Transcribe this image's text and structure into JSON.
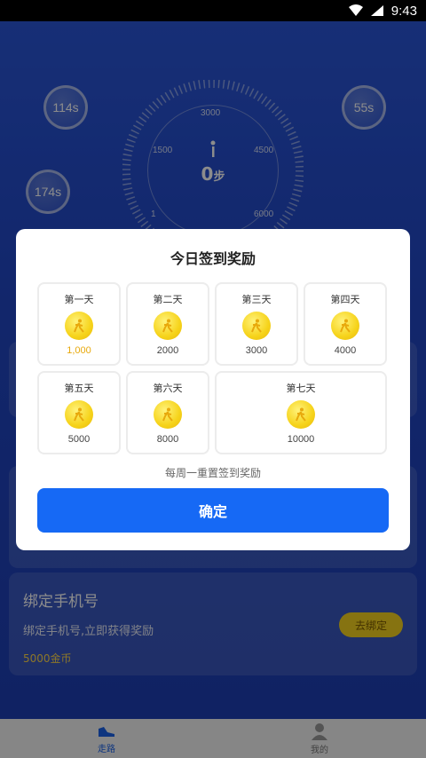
{
  "status_bar": {
    "time": "9:43"
  },
  "background": {
    "bubbles": [
      "114s",
      "55s",
      "174s"
    ],
    "gauge": {
      "ticks": [
        "3000",
        "1500",
        "4500",
        "1",
        "6000"
      ],
      "steps_value": "0",
      "steps_unit": "步"
    },
    "bind_card": {
      "title": "绑定手机号",
      "desc": "绑定手机号,立即获得奖励",
      "reward": "5000金币",
      "button": "去绑定"
    }
  },
  "tab_bar": {
    "tabs": [
      {
        "label": "走路",
        "icon": "shoe-icon",
        "active": true
      },
      {
        "label": "我的",
        "icon": "user-icon",
        "active": false
      }
    ]
  },
  "modal": {
    "title": "今日签到奖励",
    "days": [
      {
        "label": "第一天",
        "amount": "1,000",
        "highlight": true
      },
      {
        "label": "第二天",
        "amount": "2000"
      },
      {
        "label": "第三天",
        "amount": "3000"
      },
      {
        "label": "第四天",
        "amount": "4000"
      },
      {
        "label": "第五天",
        "amount": "5000"
      },
      {
        "label": "第六天",
        "amount": "8000"
      },
      {
        "label": "第七天",
        "amount": "10000"
      }
    ],
    "note": "每周一重置签到奖励",
    "confirm_label": "确定"
  },
  "colors": {
    "primary": "#1669f5",
    "coin": "#f6d31a",
    "highlight_amount": "#e8a90c"
  }
}
